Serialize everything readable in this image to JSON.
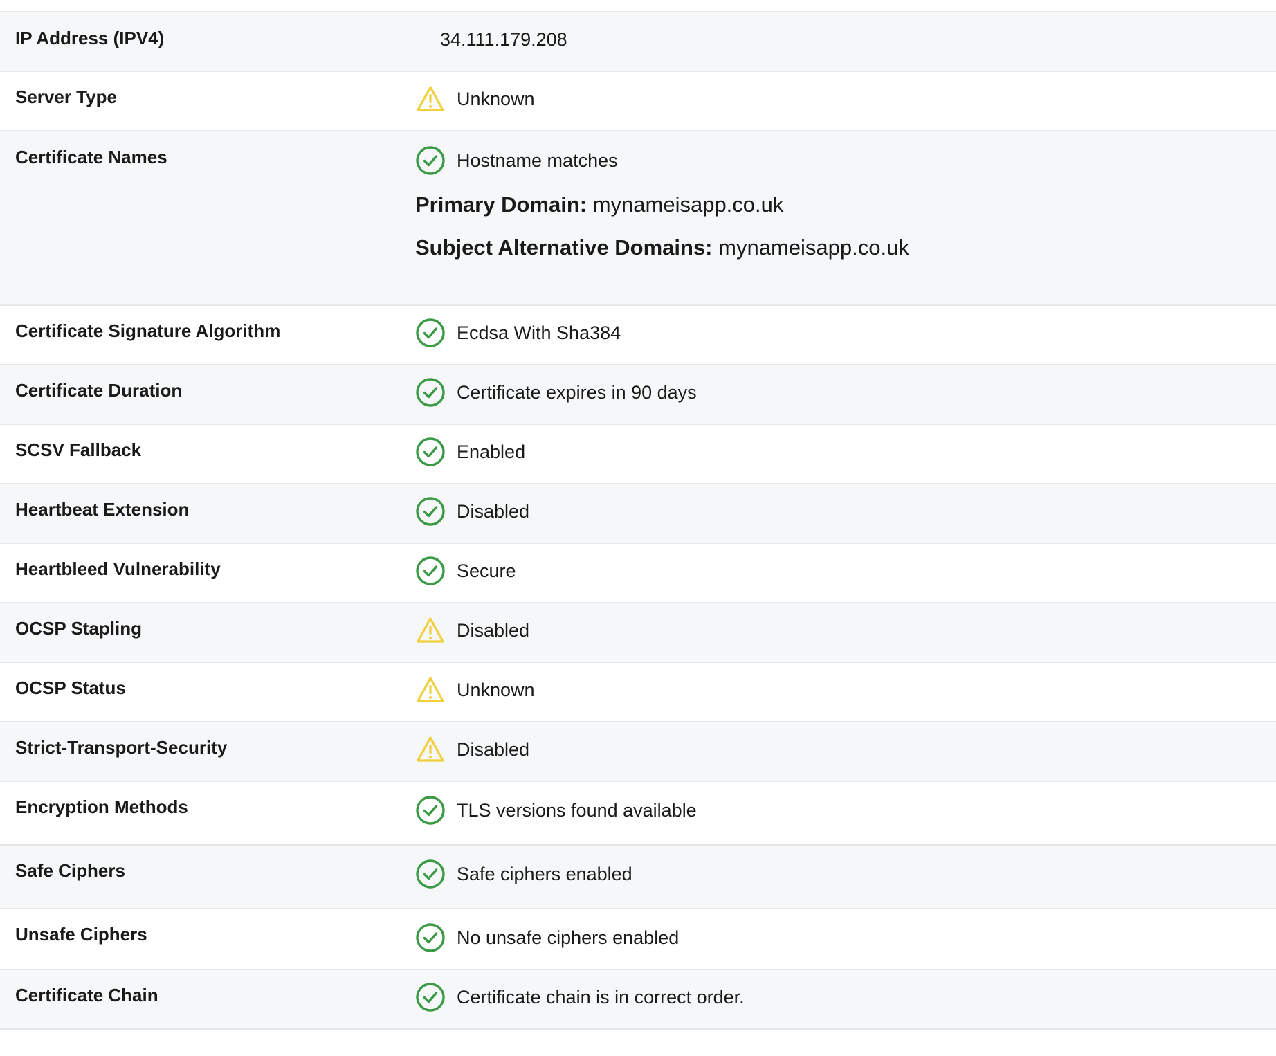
{
  "colors": {
    "pass": "#3a9a45",
    "warn": "#f2cf3c",
    "shaded_row": "#f5f7f8",
    "divider": "#e6e7e8"
  },
  "rows": [
    {
      "label": "IP Address (IPV4)",
      "value": "34.111.179.208"
    },
    {
      "label": "Server Type",
      "status_icon": "warning-icon",
      "value": "Unknown"
    },
    {
      "label": "Certificate Names",
      "status_icon": "check-circle-icon",
      "value": "Hostname matches",
      "primary_domain_key": "Primary Domain:",
      "primary_domain_value": "mynameisapp.co.uk",
      "san_key": "Subject Alternative Domains:",
      "san_value": "mynameisapp.co.uk"
    },
    {
      "label": "Certificate Signature Algorithm",
      "status_icon": "check-circle-icon",
      "value": "Ecdsa With Sha384"
    },
    {
      "label": "Certificate Duration",
      "status_icon": "check-circle-icon",
      "value": "Certificate expires in 90 days"
    },
    {
      "label": "SCSV Fallback",
      "status_icon": "check-circle-icon",
      "value": "Enabled"
    },
    {
      "label": "Heartbeat Extension",
      "status_icon": "check-circle-icon",
      "value": "Disabled"
    },
    {
      "label": "Heartbleed Vulnerability",
      "status_icon": "check-circle-icon",
      "value": "Secure"
    },
    {
      "label": "OCSP Stapling",
      "status_icon": "warning-icon",
      "value": "Disabled"
    },
    {
      "label": "OCSP Status",
      "status_icon": "warning-icon",
      "value": "Unknown"
    },
    {
      "label": "Strict-Transport-Security",
      "status_icon": "warning-icon",
      "value": "Disabled"
    },
    {
      "label": "Encryption Methods",
      "status_icon": "check-circle-icon",
      "value": "TLS versions found available"
    },
    {
      "label": "Safe Ciphers",
      "status_icon": "check-circle-icon",
      "value": "Safe ciphers enabled"
    },
    {
      "label": "Unsafe Ciphers",
      "status_icon": "check-circle-icon",
      "value": "No unsafe ciphers enabled"
    },
    {
      "label": "Certificate Chain",
      "status_icon": "check-circle-icon",
      "value": "Certificate chain is in correct order."
    }
  ]
}
